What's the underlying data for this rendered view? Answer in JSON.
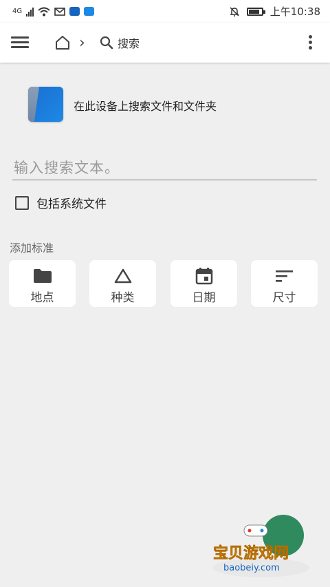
{
  "status_bar": {
    "network": "4G",
    "time": "上午10:38"
  },
  "toolbar": {
    "search_crumb_label": "搜索"
  },
  "header": {
    "description": "在此设备上搜索文件和文件夹"
  },
  "search": {
    "placeholder": "输入搜索文本。",
    "value": ""
  },
  "system_files": {
    "label": "包括系统文件",
    "checked": false
  },
  "criteria": {
    "title": "添加标准",
    "items": [
      {
        "label": "地点",
        "icon": "folder-icon"
      },
      {
        "label": "种类",
        "icon": "triangle-icon"
      },
      {
        "label": "日期",
        "icon": "calendar-icon"
      },
      {
        "label": "尺寸",
        "icon": "sort-lines-icon"
      }
    ]
  },
  "watermark": {
    "title": "宝贝游戏网",
    "url": "baobeiy.com"
  }
}
